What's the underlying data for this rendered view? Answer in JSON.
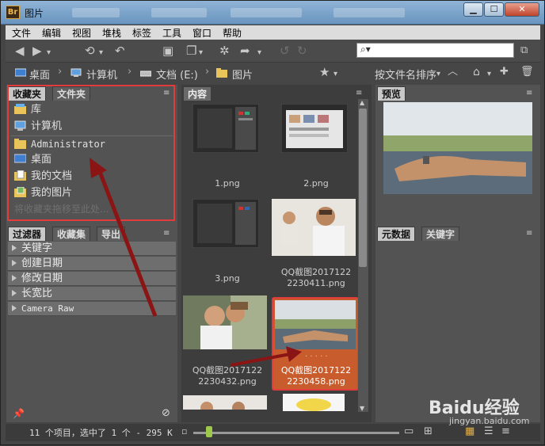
{
  "window": {
    "title": "图片",
    "app_badge": "Br"
  },
  "menu": [
    "文件",
    "编辑",
    "视图",
    "堆栈",
    "标签",
    "工具",
    "窗口",
    "帮助"
  ],
  "path": {
    "items": [
      "桌面",
      "计算机",
      "文档 (E:)",
      "图片"
    ]
  },
  "sort_label": "按文件名排序",
  "left_panel": {
    "tabs": [
      "收藏夹",
      "文件夹"
    ],
    "favorites": [
      "库",
      "计算机",
      "Administrator",
      "桌面",
      "我的文档",
      "我的图片"
    ],
    "hint": "将收藏夹拖移至此处...",
    "filter_tabs": [
      "过滤器",
      "收藏集",
      "导出"
    ],
    "filters": [
      "关键字",
      "创建日期",
      "修改日期",
      "长宽比",
      "Camera Raw"
    ]
  },
  "content_panel": {
    "tab": "内容",
    "items": [
      {
        "label": "1.png",
        "selected": false
      },
      {
        "label": "2.png",
        "selected": false
      },
      {
        "label": "3.png",
        "selected": false
      },
      {
        "label_line1": "QQ截图2017122",
        "label_line2": "2230411.png",
        "selected": false
      },
      {
        "label_line1": "QQ截图2017122",
        "label_line2": "2230432.png",
        "selected": false
      },
      {
        "label_line1": "QQ截图2017122",
        "label_line2": "2230458.png",
        "selected": true
      }
    ]
  },
  "right_panel": {
    "preview_tab": "预览",
    "meta_tabs": [
      "元数据",
      "关键字"
    ]
  },
  "status": {
    "text": "11 个项目，选中了 1 个 - 295 K"
  },
  "watermark": {
    "brand": "Baidu经验",
    "url": "jingyan.baidu.com"
  },
  "colors": {
    "highlight": "#e23b3b",
    "selection": "#c95c2c",
    "accent": "#9ec84a"
  }
}
